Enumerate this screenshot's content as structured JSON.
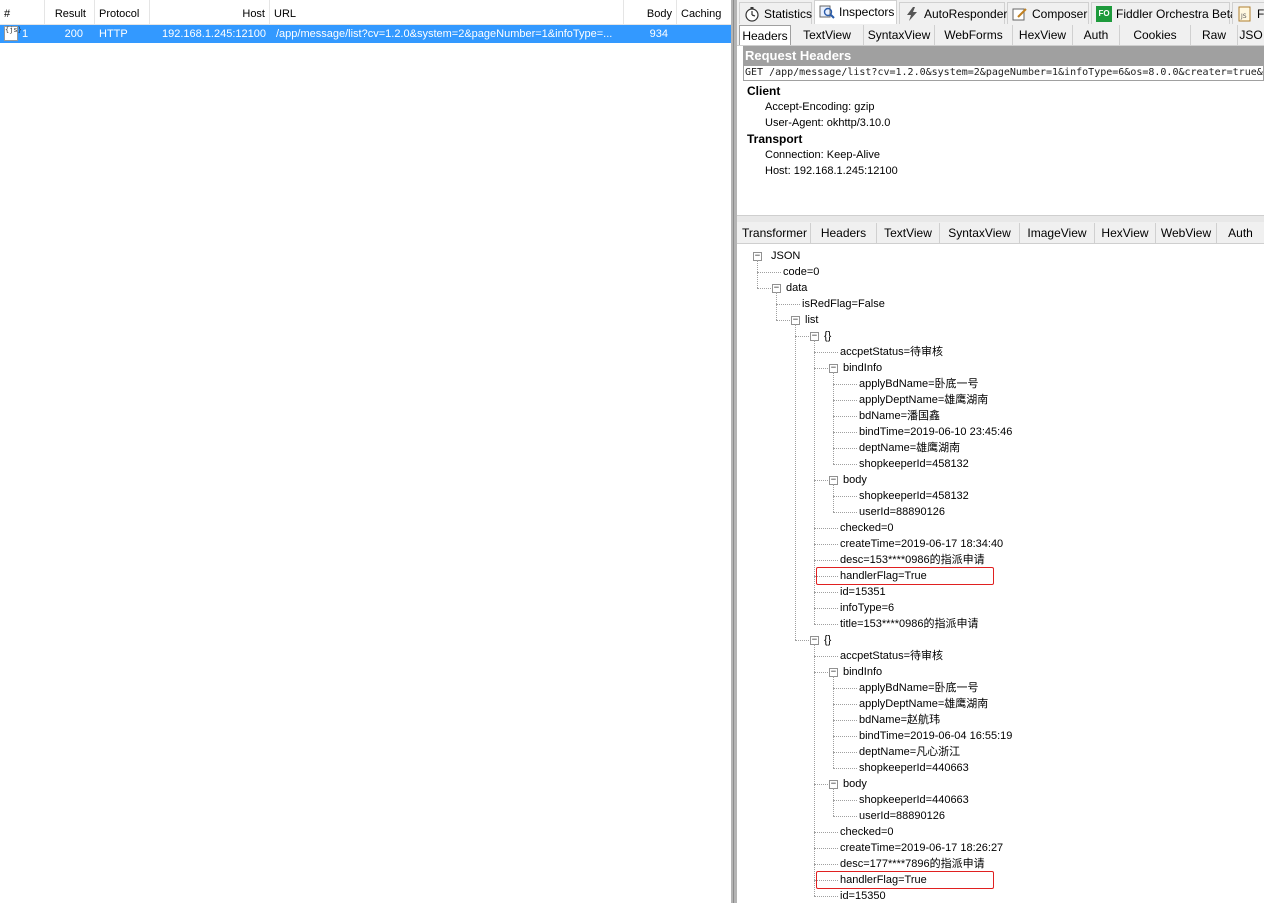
{
  "sessions": {
    "columns": [
      "#",
      "Result",
      "Protocol",
      "Host",
      "URL",
      "Body",
      "Caching"
    ],
    "rows": [
      {
        "id": "1",
        "result": "200",
        "protocol": "HTTP",
        "host": "192.168.1.245:12100",
        "url": "/app/message/list?cv=1.2.0&system=2&pageNumber=1&infoType=...",
        "body": "934",
        "caching": "",
        "icon_text": "{js\non}"
      }
    ]
  },
  "inspectors": {
    "main_tabs": [
      {
        "label": "Statistics",
        "icon": "stopwatch-icon"
      },
      {
        "label": "Inspectors",
        "icon": "magnifier-icon"
      },
      {
        "label": "AutoResponder",
        "icon": "lightning-icon"
      },
      {
        "label": "Composer",
        "icon": "compose-icon"
      },
      {
        "label": "Fiddler Orchestra Beta",
        "icon": "fo-icon",
        "icon_text": "FO"
      },
      {
        "label": "F",
        "icon": "js-icon"
      }
    ],
    "request_tabs": [
      "Headers",
      "TextView",
      "SyntaxView",
      "WebForms",
      "HexView",
      "Auth",
      "Cookies",
      "Raw",
      "JSO"
    ],
    "request_headers": {
      "title": "Request Headers",
      "request_line": "GET /app/message/list?cv=1.2.0&system=2&pageNumber=1&infoType=6&os=8.0.0&creater=true&s",
      "groups": [
        {
          "name": "Client",
          "items": [
            "Accept-Encoding: gzip",
            "User-Agent: okhttp/3.10.0"
          ]
        },
        {
          "name": "Transport",
          "items": [
            "Connection: Keep-Alive",
            "Host: 192.168.1.245:12100"
          ]
        }
      ]
    },
    "response_tabs": [
      "Transformer",
      "Headers",
      "TextView",
      "SyntaxView",
      "ImageView",
      "HexView",
      "WebView",
      "Auth"
    ],
    "json_tree": [
      {
        "t": "JSON",
        "d": 0,
        "box": "-"
      },
      {
        "t": "code=0",
        "d": 1
      },
      {
        "t": "data",
        "d": 1,
        "box": "-"
      },
      {
        "t": "isRedFlag=False",
        "d": 2
      },
      {
        "t": "list",
        "d": 2,
        "box": "-"
      },
      {
        "t": "{}",
        "d": 3,
        "box": "-"
      },
      {
        "t": "accpetStatus=待审核",
        "d": 4
      },
      {
        "t": "bindInfo",
        "d": 4,
        "box": "-"
      },
      {
        "t": "applyBdName=卧底一号",
        "d": 5
      },
      {
        "t": "applyDeptName=雄鹰湖南",
        "d": 5
      },
      {
        "t": "bdName=潘国鑫",
        "d": 5
      },
      {
        "t": "bindTime=2019-06-10 23:45:46",
        "d": 5
      },
      {
        "t": "deptName=雄鹰湖南",
        "d": 5
      },
      {
        "t": "shopkeeperId=458132",
        "d": 5
      },
      {
        "t": "body",
        "d": 4,
        "box": "-"
      },
      {
        "t": "shopkeeperId=458132",
        "d": 5
      },
      {
        "t": "userId=88890126",
        "d": 5
      },
      {
        "t": "checked=0",
        "d": 4
      },
      {
        "t": "createTime=2019-06-17 18:34:40",
        "d": 4
      },
      {
        "t": "desc=153****0986的指派申请",
        "d": 4
      },
      {
        "t": "handlerFlag=True",
        "d": 4,
        "hl": true
      },
      {
        "t": "id=15351",
        "d": 4
      },
      {
        "t": "infoType=6",
        "d": 4
      },
      {
        "t": "title=153****0986的指派申请",
        "d": 4
      },
      {
        "t": "{}",
        "d": 3,
        "box": "-"
      },
      {
        "t": "accpetStatus=待审核",
        "d": 4
      },
      {
        "t": "bindInfo",
        "d": 4,
        "box": "-"
      },
      {
        "t": "applyBdName=卧底一号",
        "d": 5
      },
      {
        "t": "applyDeptName=雄鹰湖南",
        "d": 5
      },
      {
        "t": "bdName=赵航玮",
        "d": 5
      },
      {
        "t": "bindTime=2019-06-04 16:55:19",
        "d": 5
      },
      {
        "t": "deptName=凡心浙江",
        "d": 5
      },
      {
        "t": "shopkeeperId=440663",
        "d": 5
      },
      {
        "t": "body",
        "d": 4,
        "box": "-"
      },
      {
        "t": "shopkeeperId=440663",
        "d": 5
      },
      {
        "t": "userId=88890126",
        "d": 5
      },
      {
        "t": "checked=0",
        "d": 4
      },
      {
        "t": "createTime=2019-06-17 18:26:27",
        "d": 4
      },
      {
        "t": "desc=177****7896的指派申请",
        "d": 4
      },
      {
        "t": "handlerFlag=True",
        "d": 4,
        "hl": true
      },
      {
        "t": "id=15350",
        "d": 4
      }
    ],
    "highlight_color": "#e02020",
    "selection_color": "#3399ff"
  }
}
